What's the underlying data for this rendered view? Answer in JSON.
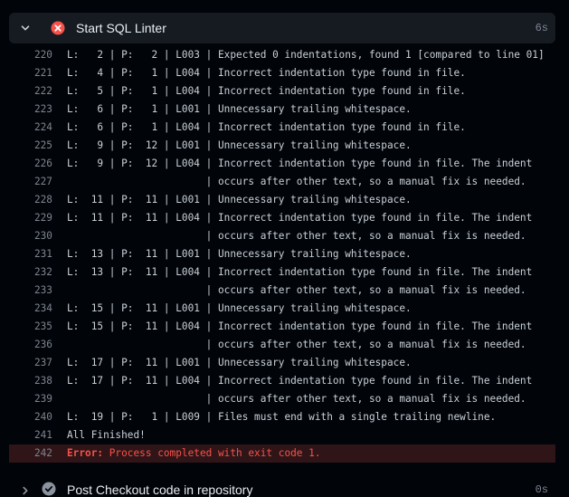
{
  "colors": {
    "background": "#010409",
    "header_bg": "#161b22",
    "text": "#e6edf3",
    "muted": "#7d8590",
    "error": "#f85149",
    "error_row_bg": "#2f1518",
    "skip_icon": "#8b949e"
  },
  "step": {
    "title": "Start SQL Linter",
    "duration": "6s",
    "status_icon": "x-circle-fill-icon",
    "expand_icon": "chevron-down-icon"
  },
  "log": {
    "lines": [
      {
        "num": "220",
        "text": "L:   2 | P:   2 | L003 | Expected 0 indentations, found 1 [compared to line 01]"
      },
      {
        "num": "221",
        "text": "L:   4 | P:   1 | L004 | Incorrect indentation type found in file."
      },
      {
        "num": "222",
        "text": "L:   5 | P:   1 | L004 | Incorrect indentation type found in file."
      },
      {
        "num": "223",
        "text": "L:   6 | P:   1 | L001 | Unnecessary trailing whitespace."
      },
      {
        "num": "224",
        "text": "L:   6 | P:   1 | L004 | Incorrect indentation type found in file."
      },
      {
        "num": "225",
        "text": "L:   9 | P:  12 | L001 | Unnecessary trailing whitespace."
      },
      {
        "num": "226",
        "text": "L:   9 | P:  12 | L004 | Incorrect indentation type found in file. The indent"
      },
      {
        "num": "227",
        "text": "                       | occurs after other text, so a manual fix is needed."
      },
      {
        "num": "228",
        "text": "L:  11 | P:  11 | L001 | Unnecessary trailing whitespace."
      },
      {
        "num": "229",
        "text": "L:  11 | P:  11 | L004 | Incorrect indentation type found in file. The indent"
      },
      {
        "num": "230",
        "text": "                       | occurs after other text, so a manual fix is needed."
      },
      {
        "num": "231",
        "text": "L:  13 | P:  11 | L001 | Unnecessary trailing whitespace."
      },
      {
        "num": "232",
        "text": "L:  13 | P:  11 | L004 | Incorrect indentation type found in file. The indent"
      },
      {
        "num": "233",
        "text": "                       | occurs after other text, so a manual fix is needed."
      },
      {
        "num": "234",
        "text": "L:  15 | P:  11 | L001 | Unnecessary trailing whitespace."
      },
      {
        "num": "235",
        "text": "L:  15 | P:  11 | L004 | Incorrect indentation type found in file. The indent"
      },
      {
        "num": "236",
        "text": "                       | occurs after other text, so a manual fix is needed."
      },
      {
        "num": "237",
        "text": "L:  17 | P:  11 | L001 | Unnecessary trailing whitespace."
      },
      {
        "num": "238",
        "text": "L:  17 | P:  11 | L004 | Incorrect indentation type found in file. The indent"
      },
      {
        "num": "239",
        "text": "                       | occurs after other text, so a manual fix is needed."
      },
      {
        "num": "240",
        "text": "L:  19 | P:   1 | L009 | Files must end with a single trailing newline."
      },
      {
        "num": "241",
        "text": "All Finished!"
      }
    ],
    "error_line": {
      "num": "242",
      "label": "Error:",
      "message": " Process completed with exit code 1."
    }
  },
  "next_step": {
    "title": "Post Checkout code in repository",
    "duration": "0s",
    "status_icon": "skipped-circle-icon",
    "expand_icon": "chevron-right-icon"
  }
}
